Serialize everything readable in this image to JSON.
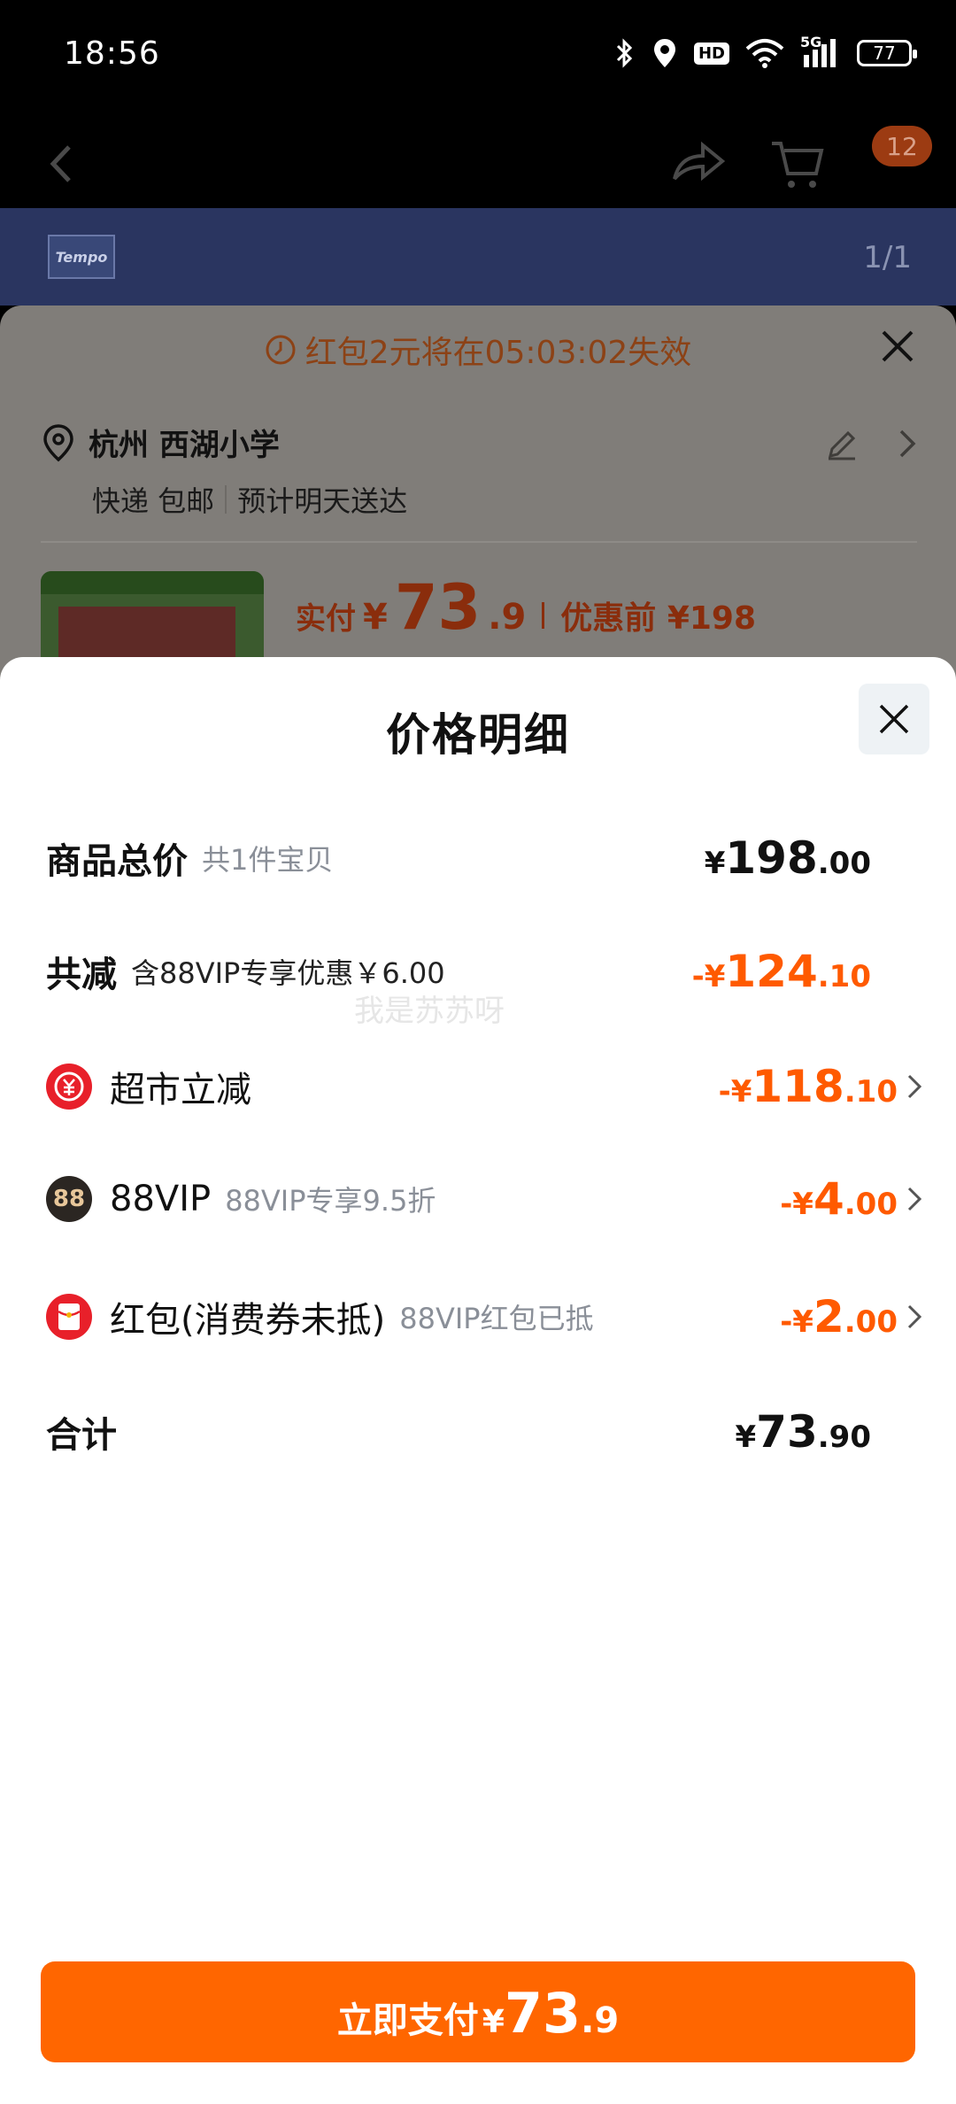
{
  "status_bar": {
    "time": "18:56",
    "battery": "77",
    "signal_label": "5G",
    "hd_label": "HD"
  },
  "background": {
    "cart_badge": "12",
    "pager": "1/1",
    "logo_text": "Tempo",
    "countdown": "红包2元将在05:03:02失效",
    "address_city": "杭州 西湖小学",
    "delivery_mode": "快递 包邮",
    "delivery_eta": "预计明天送达",
    "paid_label": "实付",
    "paid_yen": "¥",
    "paid_int": "73",
    "paid_dec": ".9",
    "before_label": "优惠前 ¥198"
  },
  "detail": {
    "title": "价格明细",
    "watermark": "我是苏苏呀",
    "rows": [
      {
        "label": "商品总价",
        "sub": "共1件宝贝",
        "yen": "¥",
        "int": "198",
        "dec": ".00"
      },
      {
        "label": "共减",
        "sub": "含88VIP专享优惠￥6.00",
        "yen": "-¥",
        "int": "124",
        "dec": ".10"
      },
      {
        "label": "超市立减",
        "sub": "",
        "yen": "-¥",
        "int": "118",
        "dec": ".10",
        "icon": "supermarket-discount-icon"
      },
      {
        "label": "88VIP",
        "sub": "88VIP专享9.5折",
        "yen": "-¥",
        "int": "4",
        "dec": ".00",
        "icon": "88vip-icon"
      },
      {
        "label": "红包(消费券未抵)",
        "sub": "88VIP红包已抵",
        "yen": "-¥",
        "int": "2",
        "dec": ".00",
        "icon": "red-packet-icon"
      },
      {
        "label": "合计",
        "sub": "",
        "yen": "¥",
        "int": "73",
        "dec": ".90"
      }
    ],
    "vip_badge": "88"
  },
  "pay_button": {
    "label": "立即支付",
    "yen": "¥",
    "int": "73",
    "dec": ".9"
  },
  "colors": {
    "accent": "#ff6600",
    "discount": "#ff5a00",
    "red_icon": "#e8202a"
  }
}
